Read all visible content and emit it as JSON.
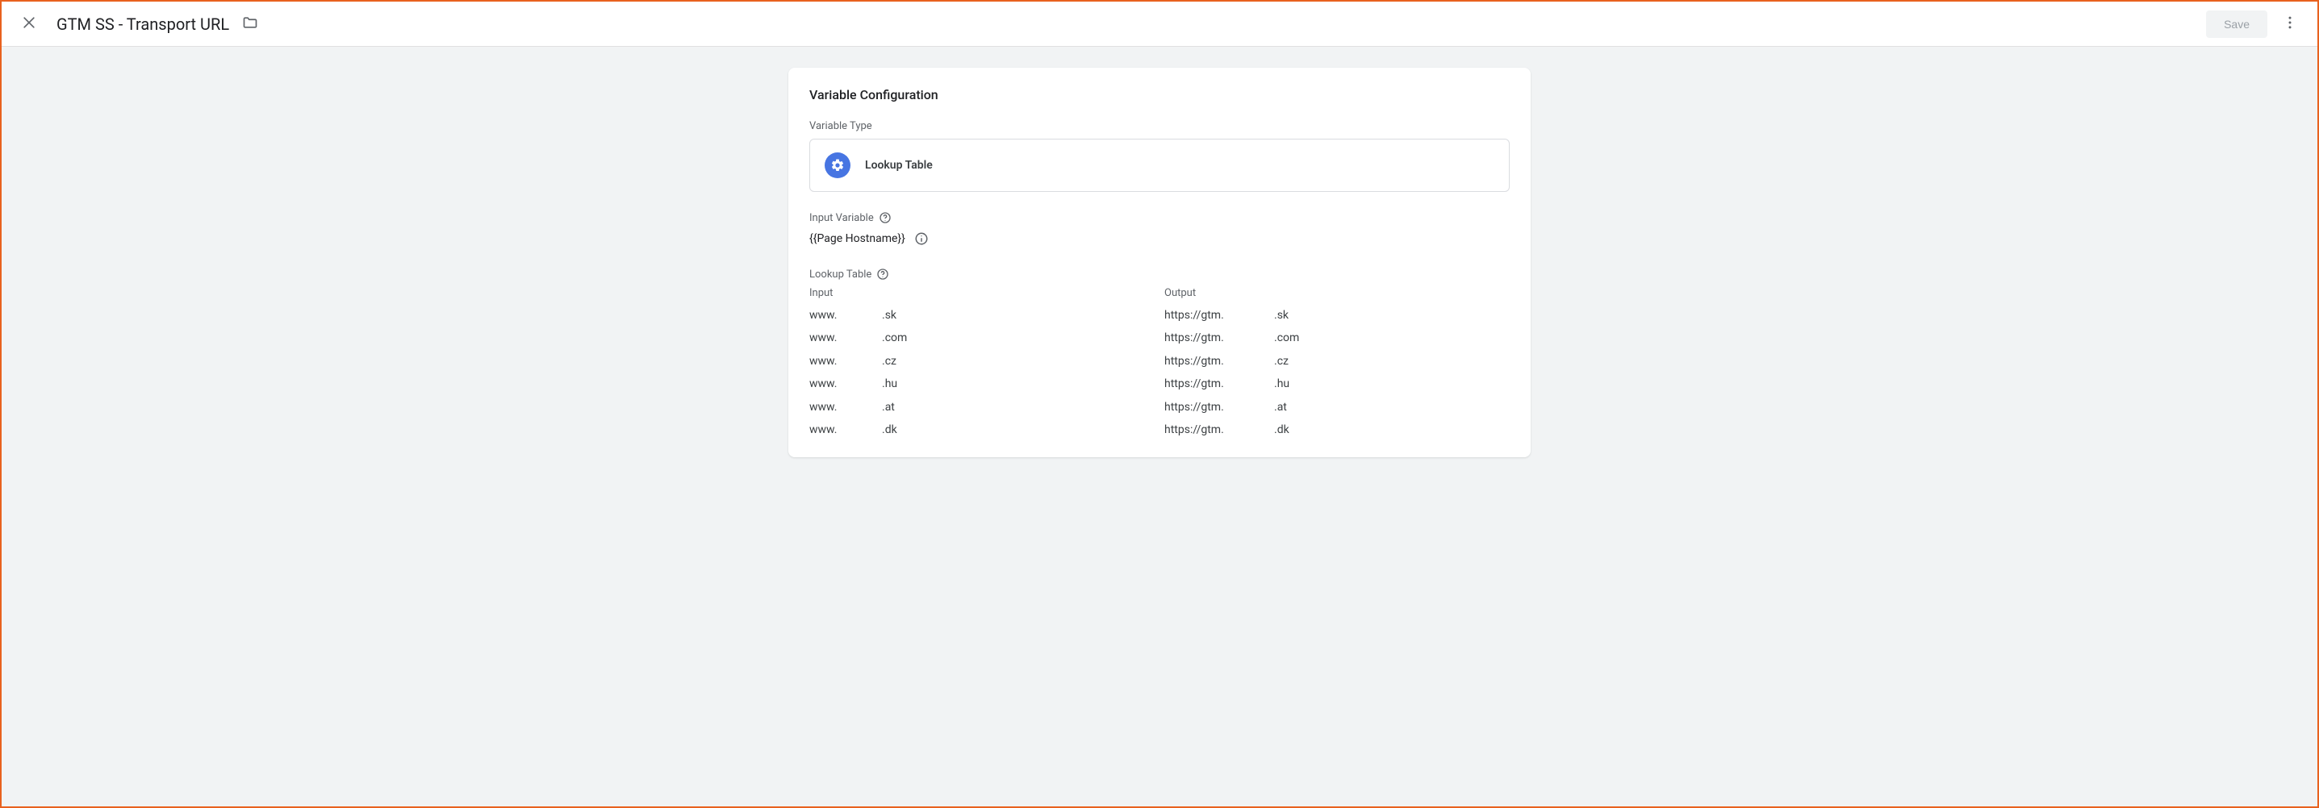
{
  "header": {
    "title": "GTM SS - Transport URL",
    "save_label": "Save"
  },
  "card": {
    "title": "Variable Configuration",
    "variable_type_label": "Variable Type",
    "variable_type_name": "Lookup Table",
    "input_variable_label": "Input Variable",
    "input_variable_value": "{{Page Hostname}}",
    "lookup_table_label": "Lookup Table",
    "columns": {
      "input": "Input",
      "output": "Output"
    },
    "rows": [
      {
        "in_prefix": "www.",
        "in_suffix": ".sk",
        "out_prefix": "https://gtm.",
        "out_suffix": ".sk"
      },
      {
        "in_prefix": "www.",
        "in_suffix": ".com",
        "out_prefix": "https://gtm.",
        "out_suffix": ".com"
      },
      {
        "in_prefix": "www.",
        "in_suffix": ".cz",
        "out_prefix": "https://gtm.",
        "out_suffix": ".cz"
      },
      {
        "in_prefix": "www.",
        "in_suffix": ".hu",
        "out_prefix": "https://gtm.",
        "out_suffix": ".hu"
      },
      {
        "in_prefix": "www.",
        "in_suffix": ".at",
        "out_prefix": "https://gtm.",
        "out_suffix": ".at"
      },
      {
        "in_prefix": "www.",
        "in_suffix": ".dk",
        "out_prefix": "https://gtm.",
        "out_suffix": ".dk"
      }
    ]
  }
}
